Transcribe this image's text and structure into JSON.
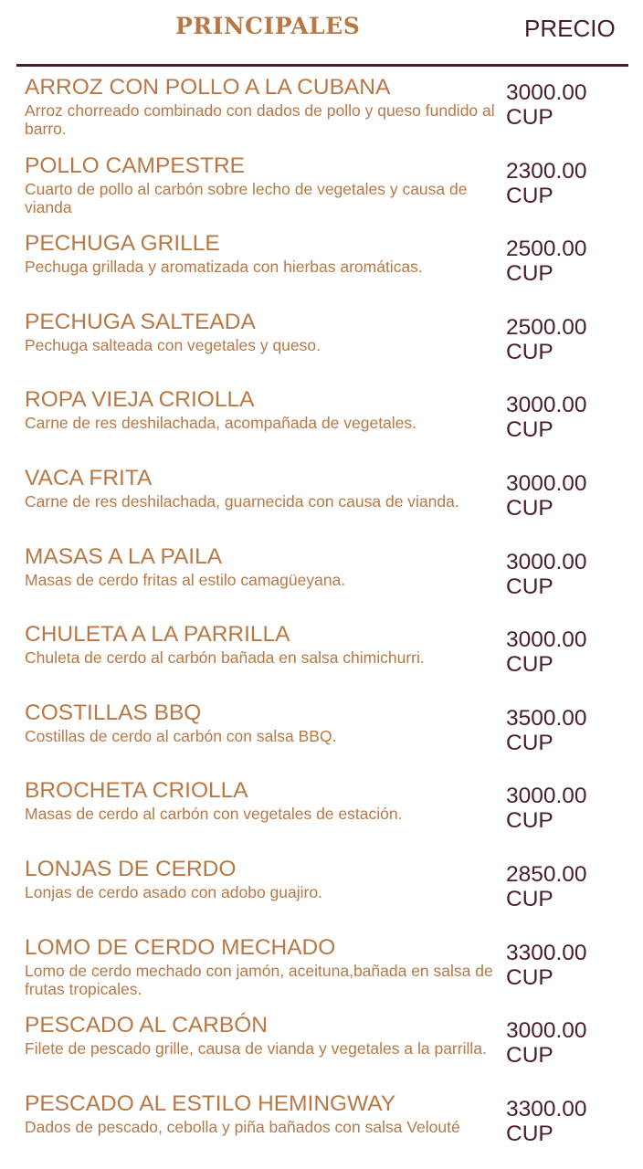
{
  "colors": {
    "accent": "#b87845",
    "price_text": "#4a1f24",
    "divider": "#4a1f24",
    "background": "#ffffff"
  },
  "header": {
    "title": "PRINCIPALES",
    "price_label": "PRECIO"
  },
  "items": [
    {
      "name": "ARROZ CON POLLO A LA CUBANA",
      "description": "Arroz chorreado combinado con dados de pollo y queso fundido al barro.",
      "price": "3000.00",
      "currency": "CUP"
    },
    {
      "name": "POLLO CAMPESTRE",
      "description": "Cuarto de pollo al carbón sobre lecho de vegetales y causa de vianda",
      "price": "2300.00",
      "currency": "CUP"
    },
    {
      "name": "PECHUGA GRILLE",
      "description": "Pechuga grillada y aromatizada con hierbas aromáticas.",
      "price": "2500.00",
      "currency": "CUP"
    },
    {
      "name": "PECHUGA SALTEADA",
      "description": "Pechuga salteada con vegetales y queso.",
      "price": "2500.00",
      "currency": "CUP"
    },
    {
      "name": "ROPA VIEJA CRIOLLA",
      "description": "Carne de res deshilachada, acompañada de vegetales.",
      "price": "3000.00",
      "currency": "CUP"
    },
    {
      "name": "VACA FRITA",
      "description": "Carne de res deshilachada, guarnecida con causa de vianda.",
      "price": "3000.00",
      "currency": "CUP"
    },
    {
      "name": "MASAS A LA PAILA",
      "description": "Masas de cerdo fritas al estilo camagüeyana.",
      "price": "3000.00",
      "currency": "CUP"
    },
    {
      "name": "CHULETA A LA PARRILLA",
      "description": "Chuleta de cerdo al carbón bañada en salsa chimichurri.",
      "price": "3000.00",
      "currency": "CUP"
    },
    {
      "name": "COSTILLAS BBQ",
      "description": "Costillas de cerdo al carbón con salsa BBQ.",
      "price": "3500.00",
      "currency": "CUP"
    },
    {
      "name": "BROCHETA CRIOLLA",
      "description": "Masas de cerdo al carbón con vegetales de estación.",
      "price": "3000.00",
      "currency": "CUP"
    },
    {
      "name": "LONJAS DE CERDO",
      "description": "Lonjas de cerdo asado con adobo guajiro.",
      "price": "2850.00",
      "currency": "CUP"
    },
    {
      "name": "LOMO DE CERDO MECHADO",
      "description": "Lomo de cerdo mechado con jamón, aceituna,bañada en salsa de frutas tropicales.",
      "price": "3300.00",
      "currency": "CUP"
    },
    {
      "name": "PESCADO AL CARBÓN",
      "description": "Filete de pescado grille, causa de vianda y vegetales a la parrilla.",
      "price": "3000.00",
      "currency": "CUP"
    },
    {
      "name": "PESCADO AL ESTILO HEMINGWAY",
      "description": "Dados de pescado, cebolla y piña bañados con salsa Velouté",
      "price": "3300.00",
      "currency": "CUP"
    }
  ]
}
